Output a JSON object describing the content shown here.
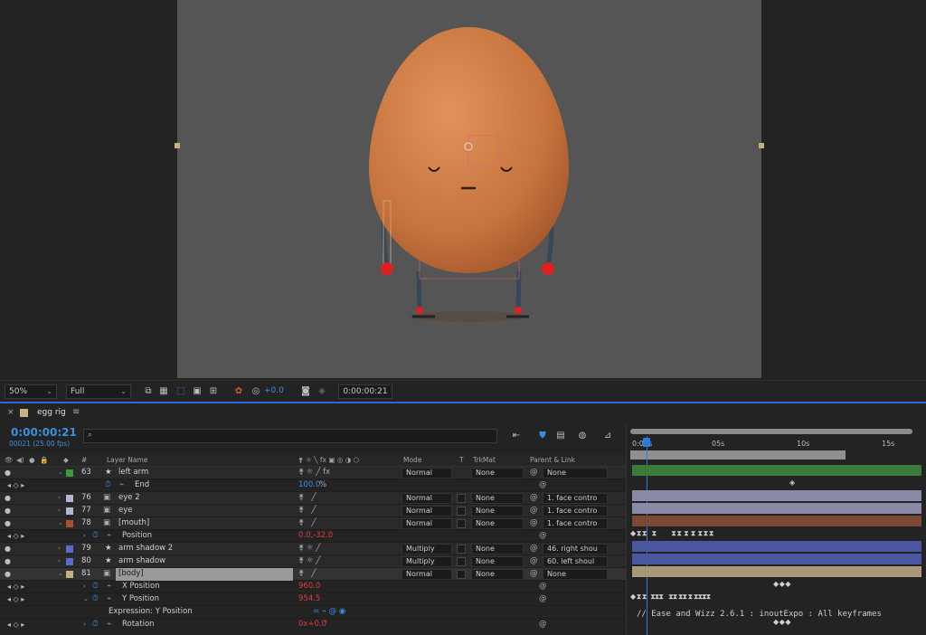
{
  "viewer": {
    "zoom": "50%",
    "resolution": "Full",
    "exposure": "+0.0",
    "timecode": "0:00:00:21"
  },
  "timeline": {
    "tab_title": "egg rig",
    "current_time": "0:00:00:21",
    "current_frame": "00021 (25.00 fps)",
    "search_placeholder": "",
    "columns": {
      "hash": "#",
      "layer_name": "Layer Name",
      "mode": "Mode",
      "t": "T",
      "trkmat": "TrkMat",
      "parent": "Parent & Link"
    },
    "ruler": [
      "0:00s",
      "05s",
      "10s",
      "15s"
    ],
    "layers": [
      {
        "num": "63",
        "name": "left arm",
        "color": "#3c9c3c",
        "mode": "Normal",
        "trkmat": "None",
        "parent": "None"
      },
      {
        "prop": "End",
        "value": "100.0",
        "unit": "%"
      },
      {
        "num": "76",
        "name": "eye 2",
        "color": "#b4b4d6",
        "mode": "Normal",
        "trkmat": "None",
        "parent": "1. face contro"
      },
      {
        "num": "77",
        "name": "eye",
        "color": "#b4b4d6",
        "mode": "Normal",
        "trkmat": "None",
        "parent": "1. face contro"
      },
      {
        "num": "78",
        "name": "[mouth]",
        "color": "#a8502e",
        "mode": "Normal",
        "trkmat": "None",
        "parent": "1. face contro"
      },
      {
        "prop": "Position",
        "value": "0.0,-32.0"
      },
      {
        "num": "79",
        "name": "arm shadow 2",
        "color": "#5a6acb",
        "mode": "Multiply",
        "trkmat": "None",
        "parent": "46. right shou"
      },
      {
        "num": "80",
        "name": "arm shadow",
        "color": "#5a6acb",
        "mode": "Multiply",
        "trkmat": "None",
        "parent": "60. left shoul"
      },
      {
        "num": "81",
        "name": "[body]",
        "color": "#c8b07a",
        "mode": "Normal",
        "trkmat": "None",
        "parent": "None"
      },
      {
        "prop": "X Position",
        "value": "960.0"
      },
      {
        "prop": "Y Position",
        "value": "954.5"
      },
      {
        "expr_label": "Expression: Y Position"
      },
      {
        "prop": "Rotation",
        "value": "0x+0.0",
        "unit": "°"
      }
    ],
    "expression_text": "// Ease and Wizz 2.6.1 : inoutExpo : All keyframes"
  },
  "colors": {
    "accent": "#2a7ae0",
    "egg": "#d9874e",
    "canvas": "#555555"
  }
}
